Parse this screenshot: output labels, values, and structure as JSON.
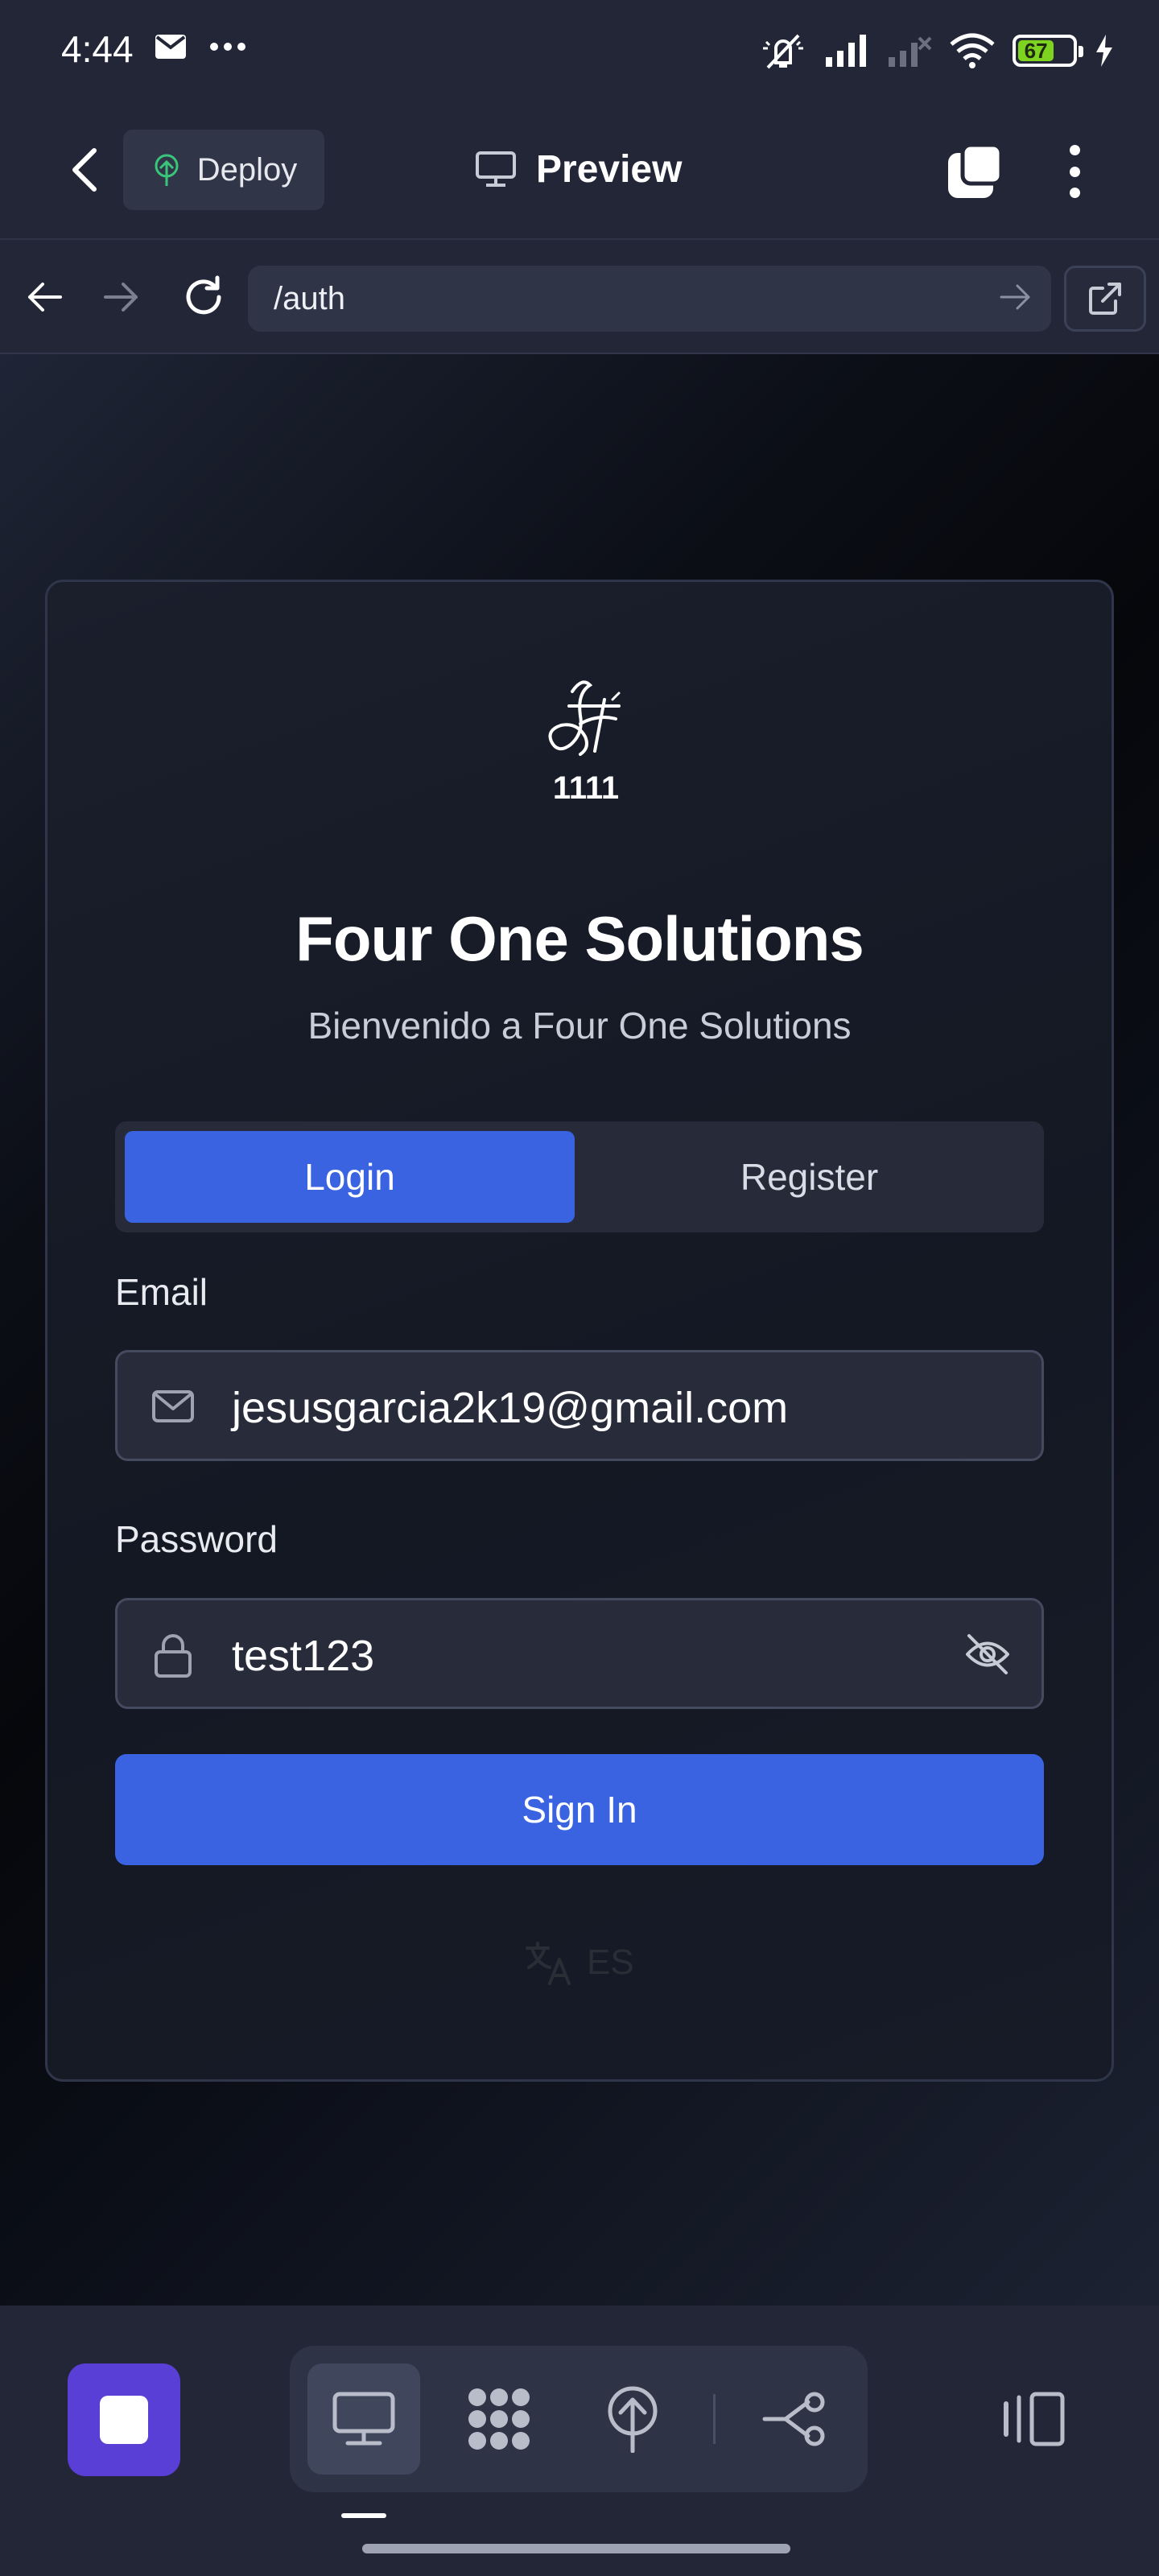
{
  "status_bar": {
    "time": "4:44",
    "battery_level": "67",
    "icons": [
      "mail-icon",
      "more-dots-icon",
      "mute-icon",
      "signal-icon",
      "signal-off-icon",
      "wifi-icon",
      "battery-icon",
      "charging-icon"
    ]
  },
  "header": {
    "deploy_label": "Deploy",
    "title": "Preview",
    "icons": [
      "back-icon",
      "deploy-icon",
      "monitor-icon",
      "tabs-icon",
      "more-vert-icon"
    ]
  },
  "browser": {
    "url": "/auth",
    "icons": [
      "back-arrow-icon",
      "forward-arrow-icon",
      "reload-icon",
      "go-arrow-icon",
      "external-link-icon"
    ]
  },
  "auth": {
    "logo_number": "1111",
    "title": "Four One Solutions",
    "subtitle": "Bienvenido a Four One Solutions",
    "tabs": [
      "Login",
      "Register"
    ],
    "active_tab": "Login",
    "email_label": "Email",
    "email_value": "jesusgarcia2k19@gmail.com",
    "password_label": "Password",
    "password_value": "test123",
    "sign_in_label": "Sign In",
    "language": "ES"
  },
  "bottom_bar": {
    "icons": [
      "stop-icon",
      "desktop-icon",
      "components-icon",
      "deploy-icon",
      "flow-icon",
      "panel-icon"
    ],
    "active_tool": "desktop"
  },
  "colors": {
    "accent": "#3a63e2",
    "stop_button": "#5a3fd6",
    "battery": "#7ed321",
    "deploy_icon": "#39c67a"
  }
}
